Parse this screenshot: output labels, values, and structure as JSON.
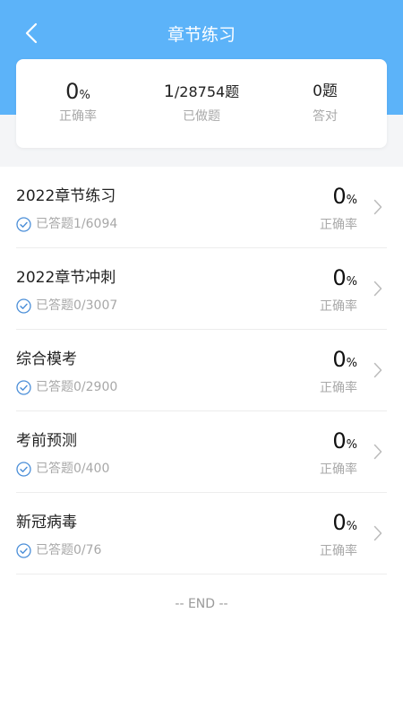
{
  "colors": {
    "header": "#5cb3f9",
    "check_icon": "#4a8ed8"
  },
  "header": {
    "title": "章节练习"
  },
  "stats": {
    "accuracy": {
      "value": "0",
      "unit": "%",
      "label": "正确率"
    },
    "done": {
      "value": "1",
      "suffix": "/28754题",
      "label": "已做题"
    },
    "correct": {
      "value": "0题",
      "label": "答对"
    }
  },
  "chapters": [
    {
      "name": "2022章节练习",
      "progress": "已答题1/6094",
      "rate": "0",
      "unit": "%",
      "rate_label": "正确率"
    },
    {
      "name": "2022章节冲刺",
      "progress": "已答题0/3007",
      "rate": "0",
      "unit": "%",
      "rate_label": "正确率"
    },
    {
      "name": "综合模考",
      "progress": "已答题0/2900",
      "rate": "0",
      "unit": "%",
      "rate_label": "正确率"
    },
    {
      "name": "考前预测",
      "progress": "已答题0/400",
      "rate": "0",
      "unit": "%",
      "rate_label": "正确率"
    },
    {
      "name": "新冠病毒",
      "progress": "已答题0/76",
      "rate": "0",
      "unit": "%",
      "rate_label": "正确率"
    }
  ],
  "footer": {
    "end_text": "-- END --"
  }
}
